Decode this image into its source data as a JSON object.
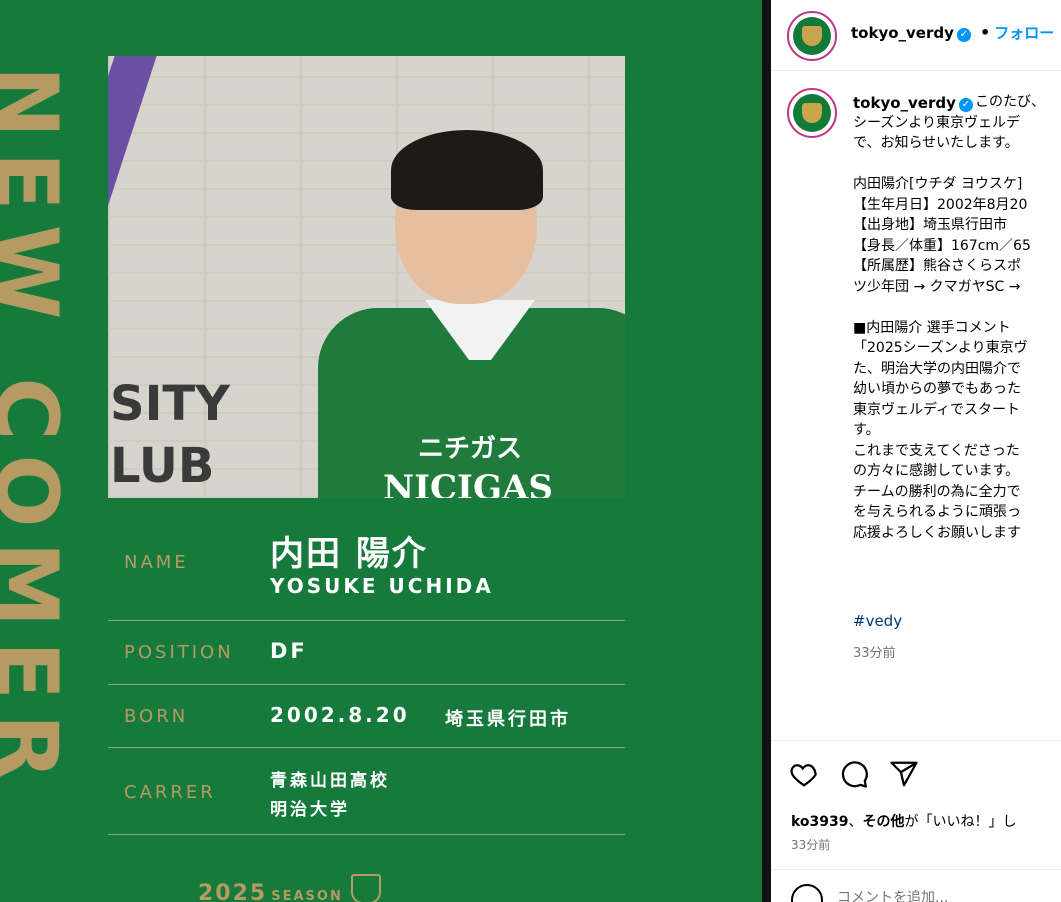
{
  "post_image": {
    "vertical_banner": "NEW COMER",
    "wall_text_top": "SITY",
    "wall_text_bottom": "LUB",
    "jersey_sponsor": "NICIGAS",
    "jersey_sponsor_jp": "ニチガス",
    "profile": {
      "name_label": "NAME",
      "name_jp": "内田 陽介",
      "name_en": "YOSUKE UCHIDA",
      "position_label": "POSITION",
      "position_value": "DF",
      "born_label": "BORN",
      "born_date": "2002.8.20",
      "born_place": "埼玉県行田市",
      "career_label": "CARRER",
      "career_line1": "青森山田高校",
      "career_line2": "明治大学"
    },
    "season_year": "2025",
    "season_label": "SEASON"
  },
  "panel": {
    "header": {
      "username": "tokyo_verdy",
      "separator": "•",
      "follow_label": "フォロー"
    },
    "caption": {
      "username": "tokyo_verdy",
      "text": "このたび、\nシーズンより東京ヴェルデ\nで、お知らせいたします。\n\n内田陽介[ウチダ ヨウスケ]\n【生年月日】2002年8月20\n【出身地】埼玉県行田市\n【身長／体重】167cm／65\n【所属歴】熊谷さくらスポ\nツ少年団 → クマガヤSC →\n\n■内田陽介 選手コメント\n「2025シーズンより東京ヴ\nた、明治大学の内田陽介で\n幼い頃からの夢でもあった\n東京ヴェルディでスタート\nす。\nこれまで支えてくださった\nの方々に感謝しています。\nチームの勝利の為に全力で\nを与えられるように頑張っ\n応援よろしくお願いします",
      "hashtag": "#vedy",
      "time": "33分前"
    },
    "likes": {
      "user": "ko3939",
      "sep": "、",
      "others": "その他",
      "suffix": "が「いいね！」し"
    },
    "time2": "33分前",
    "comment_placeholder": "コメントを追加..."
  },
  "colors": {
    "green": "#157a3c",
    "gold": "#b59b62",
    "link": "#0095f6"
  }
}
